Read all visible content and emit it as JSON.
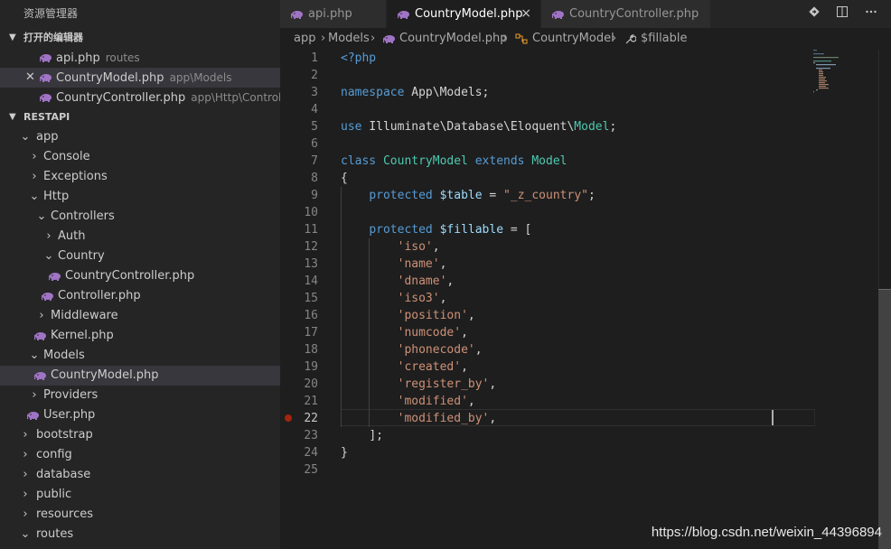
{
  "sidebar": {
    "title": "资源管理器",
    "open_editors_label": "打开的编辑器",
    "open_editors": [
      {
        "name": "api.php",
        "desc": "routes"
      },
      {
        "name": "CountryModel.php",
        "desc": "app\\Models"
      },
      {
        "name": "CountryController.php",
        "desc": "app\\Http\\Controller..."
      }
    ],
    "project_label": "RESTAPI",
    "tree": [
      {
        "label": "app",
        "chev": "⌄"
      },
      {
        "label": "Console",
        "chev": "›"
      },
      {
        "label": "Exceptions",
        "chev": "›"
      },
      {
        "label": "Http",
        "chev": "⌄"
      },
      {
        "label": "Controllers",
        "chev": "⌄"
      },
      {
        "label": "Auth",
        "chev": "›"
      },
      {
        "label": "Country",
        "chev": "⌄"
      },
      {
        "label": "CountryController.php"
      },
      {
        "label": "Controller.php"
      },
      {
        "label": "Middleware",
        "chev": "›"
      },
      {
        "label": "Kernel.php"
      },
      {
        "label": "Models",
        "chev": "⌄"
      },
      {
        "label": "CountryModel.php"
      },
      {
        "label": "Providers",
        "chev": "›"
      },
      {
        "label": "User.php"
      },
      {
        "label": "bootstrap",
        "chev": "›"
      },
      {
        "label": "config",
        "chev": "›"
      },
      {
        "label": "database",
        "chev": "›"
      },
      {
        "label": "public",
        "chev": "›"
      },
      {
        "label": "resources",
        "chev": "›"
      },
      {
        "label": "routes",
        "chev": "⌄"
      }
    ]
  },
  "tabs": [
    {
      "label": "api.php"
    },
    {
      "label": "CountryModel.php",
      "close": "×"
    },
    {
      "label": "CountryController.php"
    }
  ],
  "breadcrumb": {
    "items": [
      "app",
      "›",
      "Models",
      "›",
      "CountryModel.php",
      "›",
      "CountryModel",
      "›",
      "$fillable"
    ]
  },
  "editor": {
    "current_line": 22,
    "lines": [
      "1",
      "2",
      "3",
      "4",
      "5",
      "6",
      "7",
      "8",
      "9",
      "10",
      "11",
      "12",
      "13",
      "14",
      "15",
      "16",
      "17",
      "18",
      "19",
      "20",
      "21",
      "22",
      "23",
      "24",
      "25"
    ],
    "code": {
      "l1": "<?php",
      "l3_kw": "namespace",
      "l3_ns": "App\\Models;",
      "l5_kw": "use",
      "l5_ns1": "Illuminate\\Database\\Eloquent\\",
      "l5_cls": "Model",
      "l5_end": ";",
      "l7_kw1": "class",
      "l7_cls1": "CountryModel",
      "l7_kw2": "extends",
      "l7_cls2": "Model",
      "l8": "{",
      "l9_kw": "protected",
      "l9_var": "$table",
      "l9_eq": " = ",
      "l9_str": "\"_z_country\"",
      "l9_end": ";",
      "l11_kw": "protected",
      "l11_var": "$fillable",
      "l11_rest": " = [",
      "items": [
        "'iso'",
        "'name'",
        "'dname'",
        "'iso3'",
        "'position'",
        "'numcode'",
        "'phonecode'",
        "'created'",
        "'register_by'",
        "'modified'",
        "'modified_by'"
      ],
      "l23": "];",
      "l24": "}"
    }
  },
  "watermark": "https://blog.csdn.net/weixin_44396894",
  "colors": {
    "elephant": "#a074c4",
    "keyword": "#569cd6",
    "class": "#4ec9b0",
    "variable": "#9cdcfe",
    "string": "#ce9178"
  }
}
